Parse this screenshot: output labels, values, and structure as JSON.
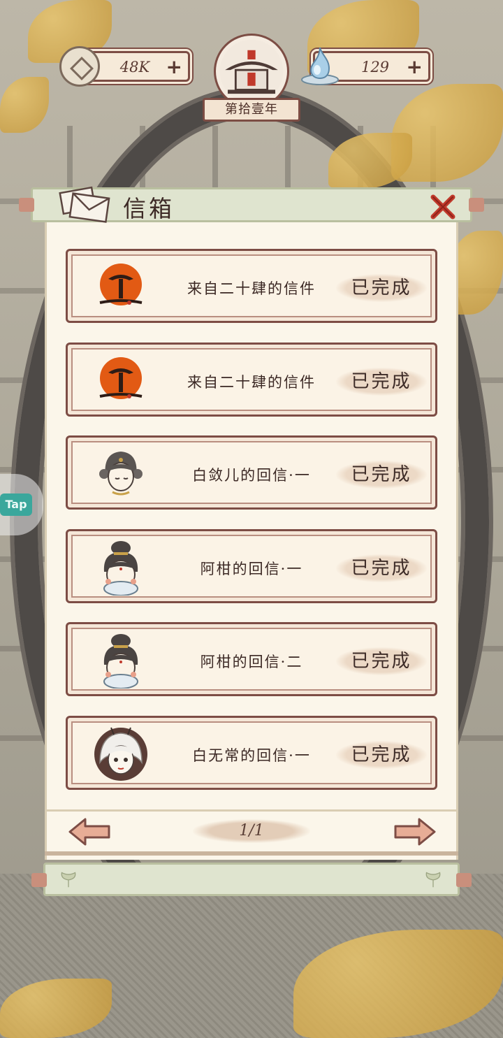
{
  "hud": {
    "coins": "48K",
    "spirit": "129",
    "year": "第拾壹年"
  },
  "mailbox": {
    "title": "信箱",
    "items": [
      {
        "title": "来自二十肆的信件",
        "status": "已完成",
        "avatar": "sun-seal-icon"
      },
      {
        "title": "来自二十肆的信件",
        "status": "已完成",
        "avatar": "sun-seal-icon"
      },
      {
        "title": "白敛儿的回信·一",
        "status": "已完成",
        "avatar": "girl-portrait-icon"
      },
      {
        "title": "阿柑的回信·一",
        "status": "已完成",
        "avatar": "bun-girl-portrait-icon"
      },
      {
        "title": "阿柑的回信·二",
        "status": "已完成",
        "avatar": "bun-girl-portrait-icon"
      },
      {
        "title": "白无常的回信·一",
        "status": "已完成",
        "avatar": "white-hair-portrait-icon"
      }
    ],
    "page": "1/1"
  },
  "side": {
    "tap_label": "Tap"
  },
  "colors": {
    "frame": "#7d4d45",
    "parchment": "#fbf3e6",
    "header_green": "#dfe4cf",
    "close_red": "#c0392b",
    "tap_teal": "#3aa79c"
  }
}
